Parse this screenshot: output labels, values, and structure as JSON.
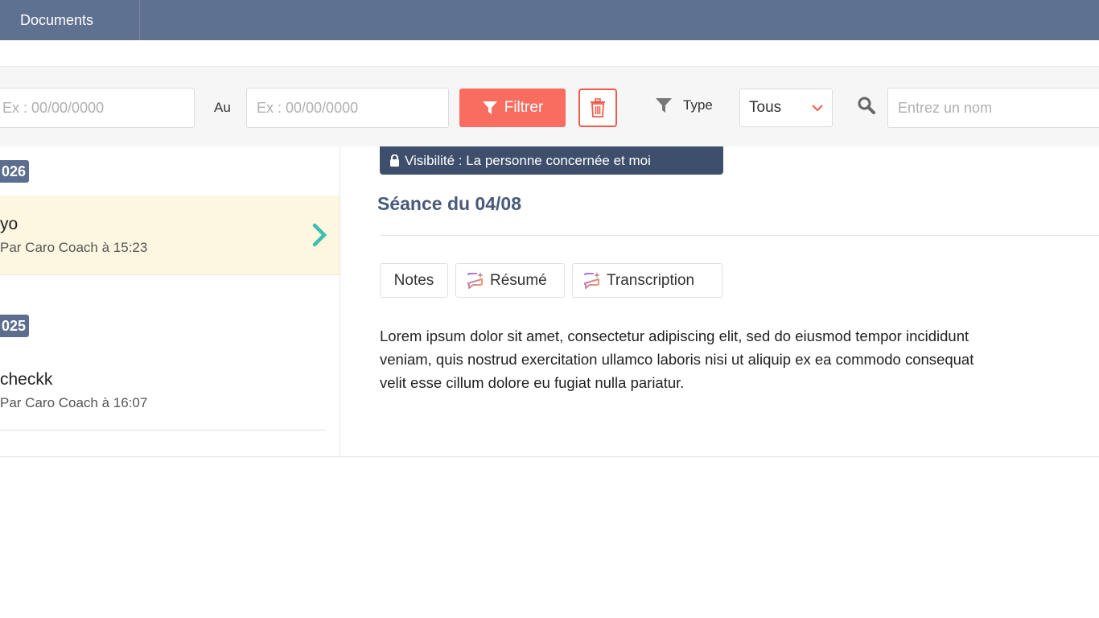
{
  "nav": {
    "documents_tab": "Documents"
  },
  "filters": {
    "date_from_placeholder": "Ex : 00/00/0000",
    "au_label": "Au",
    "date_to_placeholder": "Ex : 00/00/0000",
    "filter_button": "Filtrer",
    "type_label": "Type",
    "type_selected": "Tous",
    "search_placeholder": "Entrez un nom",
    "accent_color": "#f86d5f"
  },
  "sessions": {
    "groups": [
      {
        "year": "026",
        "items": [
          {
            "title": "yo",
            "subtitle": "Par Caro Coach à 15:23"
          }
        ]
      },
      {
        "year": "025",
        "items": [
          {
            "title": "checkk",
            "subtitle": "Par Caro Coach à 16:07"
          }
        ]
      }
    ]
  },
  "detail": {
    "visibility": "Visibilité : La personne concernée et moi",
    "title": "Séance du 04/08",
    "tabs": [
      "Notes",
      "Résumé",
      "Transcription"
    ],
    "body": "Lorem ipsum dolor sit amet, consectetur adipiscing elit, sed do eiusmod tempor incididunt\nveniam, quis nostrud exercitation ullamco laboris nisi ut aliquip ex ea commodo consequat\nvelit esse cillum dolore eu fugiat nulla pariatur."
  }
}
